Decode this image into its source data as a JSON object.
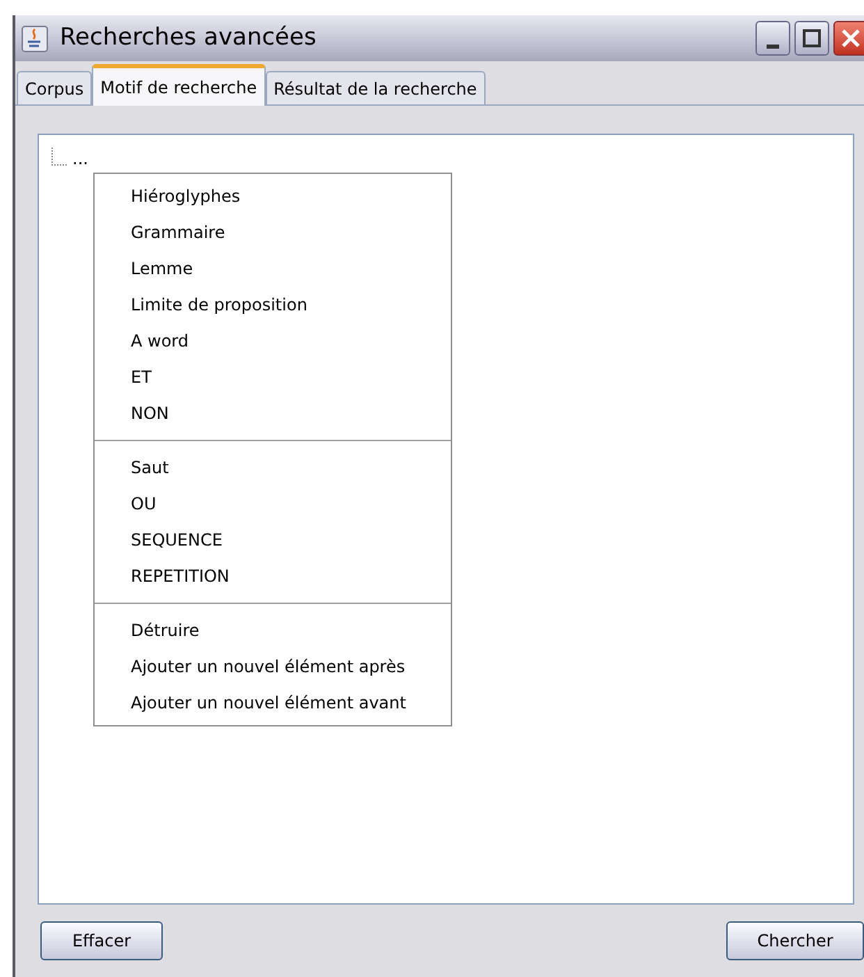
{
  "window": {
    "title": "Recherches avancées"
  },
  "tabs": [
    {
      "label": "Corpus",
      "selected": false
    },
    {
      "label": "Motif de recherche",
      "selected": true
    },
    {
      "label": "Résultat de la recherche",
      "selected": false
    }
  ],
  "tree": {
    "node": "..."
  },
  "context_menu": [
    {
      "kind": "item",
      "label": "Hiéroglyphes"
    },
    {
      "kind": "item",
      "label": "Grammaire"
    },
    {
      "kind": "item",
      "label": "Lemme"
    },
    {
      "kind": "item",
      "label": "Limite de proposition"
    },
    {
      "kind": "item",
      "label": "A word"
    },
    {
      "kind": "item",
      "label": "ET"
    },
    {
      "kind": "item",
      "label": "NON"
    },
    {
      "kind": "separator"
    },
    {
      "kind": "item",
      "label": "Saut"
    },
    {
      "kind": "item",
      "label": "OU"
    },
    {
      "kind": "item",
      "label": "SEQUENCE"
    },
    {
      "kind": "item",
      "label": "REPETITION"
    },
    {
      "kind": "separator"
    },
    {
      "kind": "item",
      "label": "Détruire"
    },
    {
      "kind": "item",
      "label": "Ajouter un nouvel élément après"
    },
    {
      "kind": "item",
      "label": "Ajouter un nouvel élément avant"
    }
  ],
  "buttons": [
    "Effacer",
    "Chercher"
  ]
}
